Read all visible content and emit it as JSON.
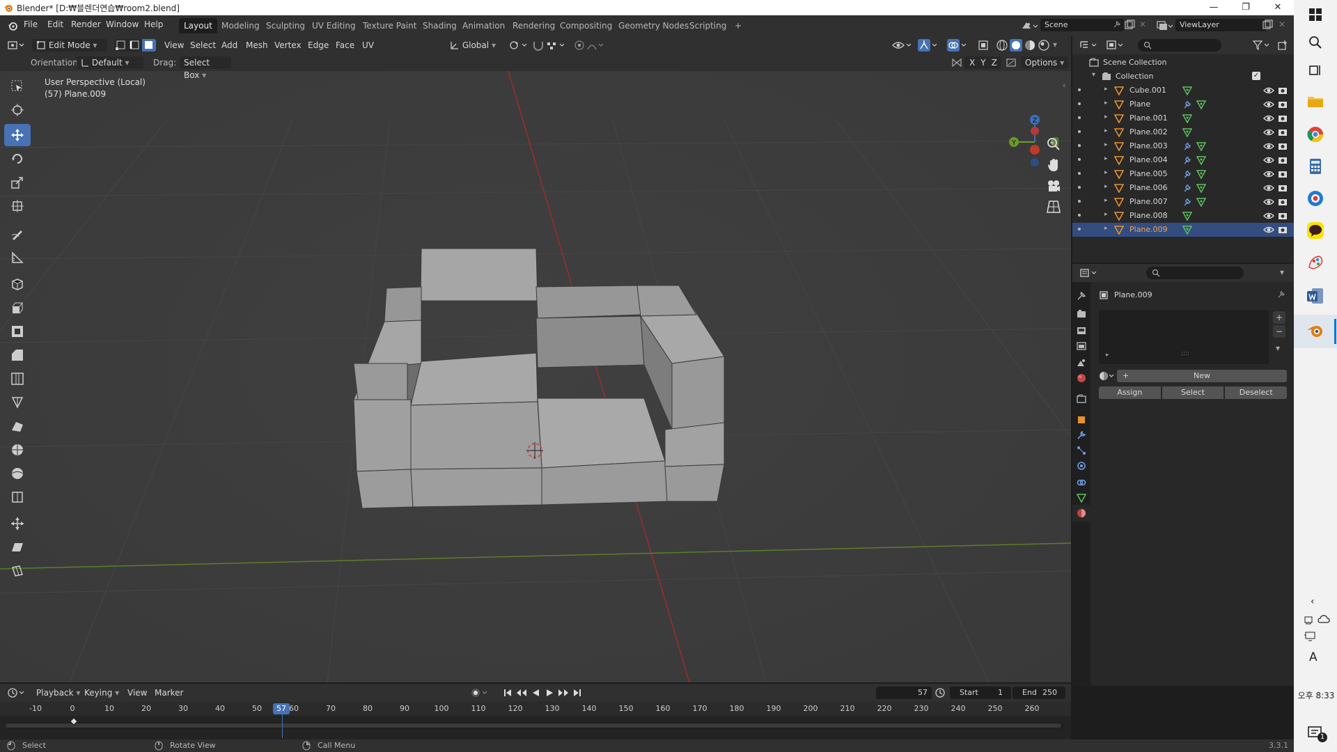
{
  "window": {
    "title": "Blender* [D:₩블렌더연습₩room2.blend]",
    "controls": [
      "—",
      "❐",
      "✕"
    ]
  },
  "menu": [
    "File",
    "Edit",
    "Render",
    "Window",
    "Help"
  ],
  "workspaces": [
    {
      "label": "Layout",
      "active": true
    },
    {
      "label": "Modeling"
    },
    {
      "label": "Sculpting"
    },
    {
      "label": "UV Editing"
    },
    {
      "label": "Texture Paint"
    },
    {
      "label": "Shading"
    },
    {
      "label": "Animation"
    },
    {
      "label": "Rendering"
    },
    {
      "label": "Compositing"
    },
    {
      "label": "Geometry Nodes"
    },
    {
      "label": "Scripting"
    },
    {
      "label": "+"
    }
  ],
  "scene": {
    "name": "Scene",
    "view_layer": "ViewLayer"
  },
  "viewport_header": {
    "mode": "Edit Mode",
    "menus": [
      "View",
      "Select",
      "Add",
      "Mesh",
      "Vertex",
      "Edge",
      "Face",
      "UV"
    ],
    "transform_orientation": "Global"
  },
  "tool_settings": {
    "orientation_label": "Orientation:",
    "orientation_value": "Default",
    "drag_label": "Drag:",
    "drag_value": "Select Box",
    "axes": [
      "X",
      "Y",
      "Z"
    ],
    "options": "Options"
  },
  "viewport_overlay": {
    "perspective": "User Perspective (Local)",
    "object": "(57) Plane.009"
  },
  "gizmo": {
    "z": "Z",
    "y": "Y"
  },
  "outliner": {
    "root": "Scene Collection",
    "collection": "Collection",
    "items": [
      {
        "name": "Cube.001",
        "modifier": false,
        "selected": false
      },
      {
        "name": "Plane",
        "modifier": true,
        "selected": false
      },
      {
        "name": "Plane.001",
        "modifier": false,
        "selected": false
      },
      {
        "name": "Plane.002",
        "modifier": false,
        "selected": false
      },
      {
        "name": "Plane.003",
        "modifier": true,
        "selected": false
      },
      {
        "name": "Plane.004",
        "modifier": true,
        "selected": false
      },
      {
        "name": "Plane.005",
        "modifier": true,
        "selected": false
      },
      {
        "name": "Plane.006",
        "modifier": true,
        "selected": false
      },
      {
        "name": "Plane.007",
        "modifier": true,
        "selected": false
      },
      {
        "name": "Plane.008",
        "modifier": false,
        "selected": false
      },
      {
        "name": "Plane.009",
        "modifier": false,
        "selected": true
      }
    ]
  },
  "properties": {
    "object_name": "Plane.009",
    "new_label": "New",
    "buttons": [
      "Assign",
      "Select",
      "Deselect"
    ]
  },
  "timeline": {
    "menus": [
      "Playback",
      "Keying",
      "View",
      "Marker"
    ],
    "current_frame": "57",
    "start_label": "Start",
    "start_value": "1",
    "end_label": "End",
    "end_value": "250",
    "ruler": [
      "-10",
      "0",
      "10",
      "20",
      "30",
      "40",
      "50",
      "60",
      "70",
      "80",
      "90",
      "100",
      "110",
      "120",
      "130",
      "140",
      "150",
      "160",
      "170",
      "180",
      "190",
      "200",
      "210",
      "220",
      "230",
      "240",
      "250",
      "260"
    ]
  },
  "statusbar": {
    "hints": [
      "Select",
      "Rotate View",
      "Call Menu"
    ],
    "version": "3.3.1"
  },
  "taskbar": {
    "ime": "A",
    "time": "오후 8:33",
    "notifications": "1"
  },
  "colors": {
    "accent": "#4772b3",
    "selected_row": "#334d80",
    "selected_text": "#f2a04e",
    "x_axis": "#c0392b",
    "y_axis": "#6b9a2a",
    "mesh_face": "#a3a3a3"
  }
}
